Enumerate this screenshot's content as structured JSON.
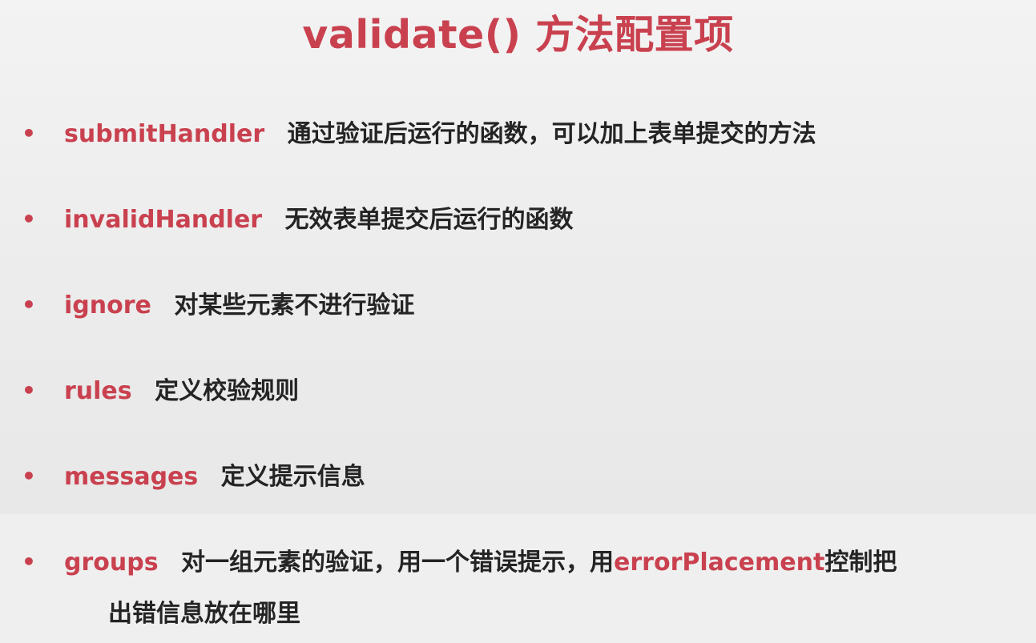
{
  "title": "validate() 方法配置项",
  "items": [
    {
      "term": "submitHandler",
      "desc": "通过验证后运行的函数，可以加上表单提交的方法"
    },
    {
      "term": "invalidHandler",
      "desc": "无效表单提交后运行的函数"
    },
    {
      "term": "ignore",
      "desc": "对某些元素不进行验证"
    },
    {
      "term": "rules",
      "desc": "定义校验规则"
    },
    {
      "term": "messages",
      "desc": "定义提示信息"
    },
    {
      "term": "groups",
      "desc_prefix": "对一组元素的验证，用一个错误提示，用",
      "inline_term": "errorPlacement",
      "desc_suffix": "控制把",
      "wrapped": "出错信息放在哪里"
    }
  ],
  "bullet_symbol": "•",
  "colors": {
    "accent": "#c9414f",
    "text": "#242424",
    "background": "#efefef"
  }
}
